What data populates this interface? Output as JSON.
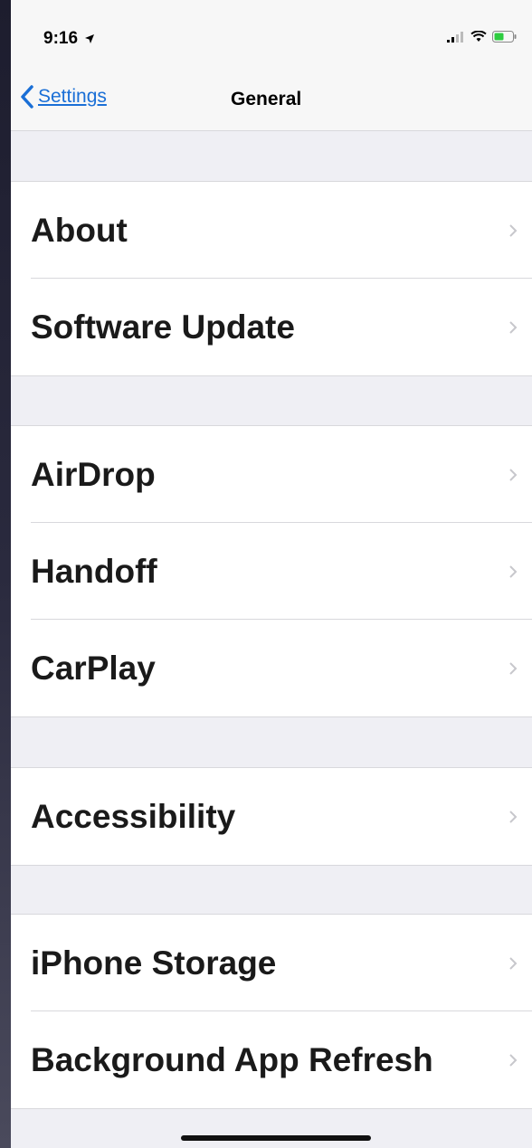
{
  "status_bar": {
    "time": "9:16",
    "icons": [
      "location-arrow-icon",
      "signal-icon",
      "wifi-icon",
      "battery-icon"
    ]
  },
  "nav": {
    "back_label": "Settings",
    "title": "General",
    "accent_color": "#1a6fd6"
  },
  "groups": [
    {
      "items": [
        {
          "label": "About"
        },
        {
          "label": "Software Update"
        }
      ]
    },
    {
      "items": [
        {
          "label": "AirDrop"
        },
        {
          "label": "Handoff"
        },
        {
          "label": "CarPlay"
        }
      ]
    },
    {
      "items": [
        {
          "label": "Accessibility"
        }
      ]
    },
    {
      "items": [
        {
          "label": "iPhone Storage"
        },
        {
          "label": "Background App Refresh"
        }
      ]
    }
  ]
}
